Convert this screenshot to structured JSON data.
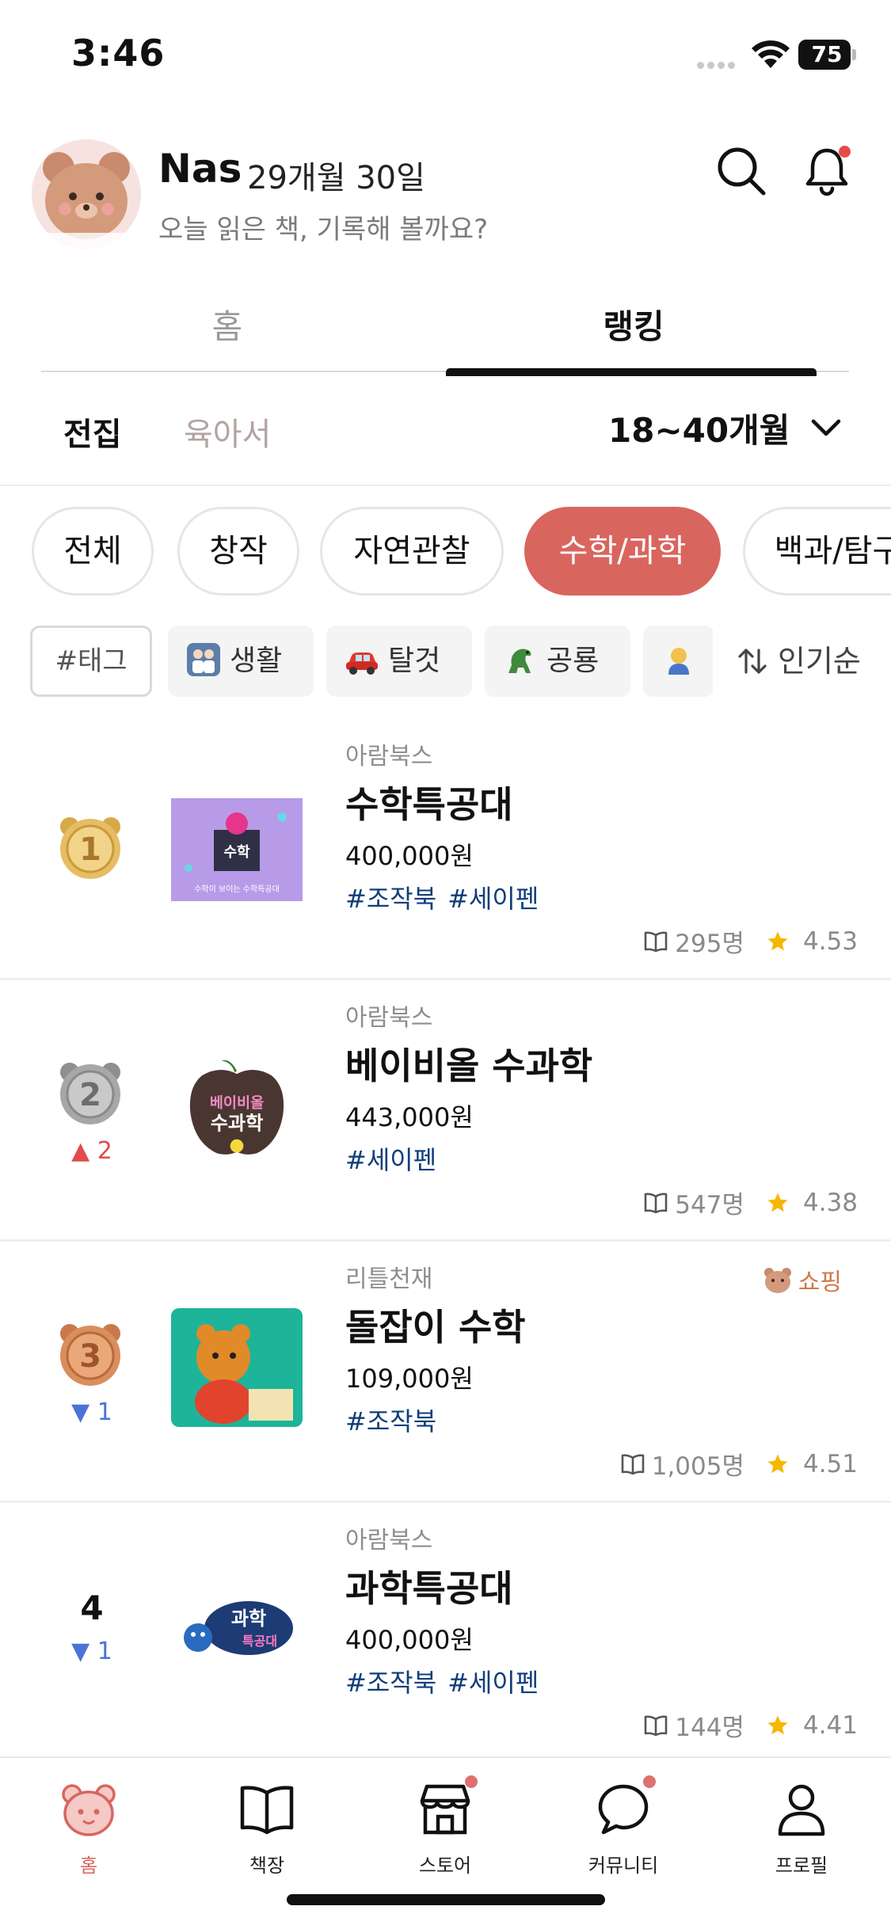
{
  "status_bar": {
    "time": "3:46",
    "battery": "75"
  },
  "profile": {
    "name": "Nas",
    "age": "29개월 30일",
    "prompt": "오늘 읽은 책, 기록해 볼까요?"
  },
  "main_tabs": [
    {
      "label": "홈",
      "active": false
    },
    {
      "label": "랭킹",
      "active": true
    }
  ],
  "sub_tabs": [
    {
      "label": "전집",
      "active": true
    },
    {
      "label": "육아서",
      "active": false
    }
  ],
  "age_filter": {
    "selected": "18~40개월"
  },
  "categories": [
    {
      "label": "전체",
      "active": false
    },
    {
      "label": "창작",
      "active": false
    },
    {
      "label": "자연관찰",
      "active": false
    },
    {
      "label": "수학/과학",
      "active": true
    },
    {
      "label": "백과/탐구",
      "active": false
    }
  ],
  "tag_filter": {
    "placeholder": "#태그",
    "tags": [
      {
        "label": "생활",
        "icon": "family-icon"
      },
      {
        "label": "탈것",
        "icon": "car-icon"
      },
      {
        "label": "공룡",
        "icon": "dinosaur-icon"
      },
      {
        "label": "",
        "icon": "child-icon"
      }
    ],
    "sort": "인기순"
  },
  "rankings": [
    {
      "rank": "1",
      "medal": "gold",
      "delta": "",
      "delta_dir": "none",
      "publisher": "아람북스",
      "title": "수학특공대",
      "price": "400,000원",
      "tags": [
        "#조작북",
        "#세이펜"
      ],
      "readers": "295명",
      "rating": "4.53",
      "badge": "",
      "cover_caption": "수학이 보이는 수학특공대"
    },
    {
      "rank": "2",
      "medal": "silver",
      "delta": "2",
      "delta_dir": "up",
      "publisher": "아람북스",
      "title": "베이비올 수과학",
      "price": "443,000원",
      "tags": [
        "#세이펜"
      ],
      "readers": "547명",
      "rating": "4.38",
      "badge": "",
      "cover_caption": "베이비올 수과학"
    },
    {
      "rank": "3",
      "medal": "bronze",
      "delta": "1",
      "delta_dir": "down",
      "publisher": "리틀천재",
      "title": "돌잡이 수학",
      "price": "109,000원",
      "tags": [
        "#조작북"
      ],
      "readers": "1,005명",
      "rating": "4.51",
      "badge": "쇼핑",
      "cover_caption": ""
    },
    {
      "rank": "4",
      "medal": "none",
      "delta": "1",
      "delta_dir": "down",
      "publisher": "아람북스",
      "title": "과학특공대",
      "price": "400,000원",
      "tags": [
        "#조작북",
        "#세이펜"
      ],
      "readers": "144명",
      "rating": "4.41",
      "badge": "",
      "cover_caption": "과학특공대"
    }
  ],
  "bottom_nav": [
    {
      "label": "홈",
      "icon": "bear-home-icon",
      "active": true,
      "dot": false
    },
    {
      "label": "책장",
      "icon": "open-book-icon",
      "active": false,
      "dot": false
    },
    {
      "label": "스토어",
      "icon": "store-icon",
      "active": false,
      "dot": true
    },
    {
      "label": "커뮤니티",
      "icon": "chat-bubble-icon",
      "active": false,
      "dot": true
    },
    {
      "label": "프로필",
      "icon": "person-icon",
      "active": false,
      "dot": false
    }
  ],
  "colors": {
    "accent": "#d9655f",
    "hashtag": "#0f3e7a",
    "rank_up": "#e24b4b",
    "rank_down": "#4a72d9",
    "star": "#f5b800"
  }
}
